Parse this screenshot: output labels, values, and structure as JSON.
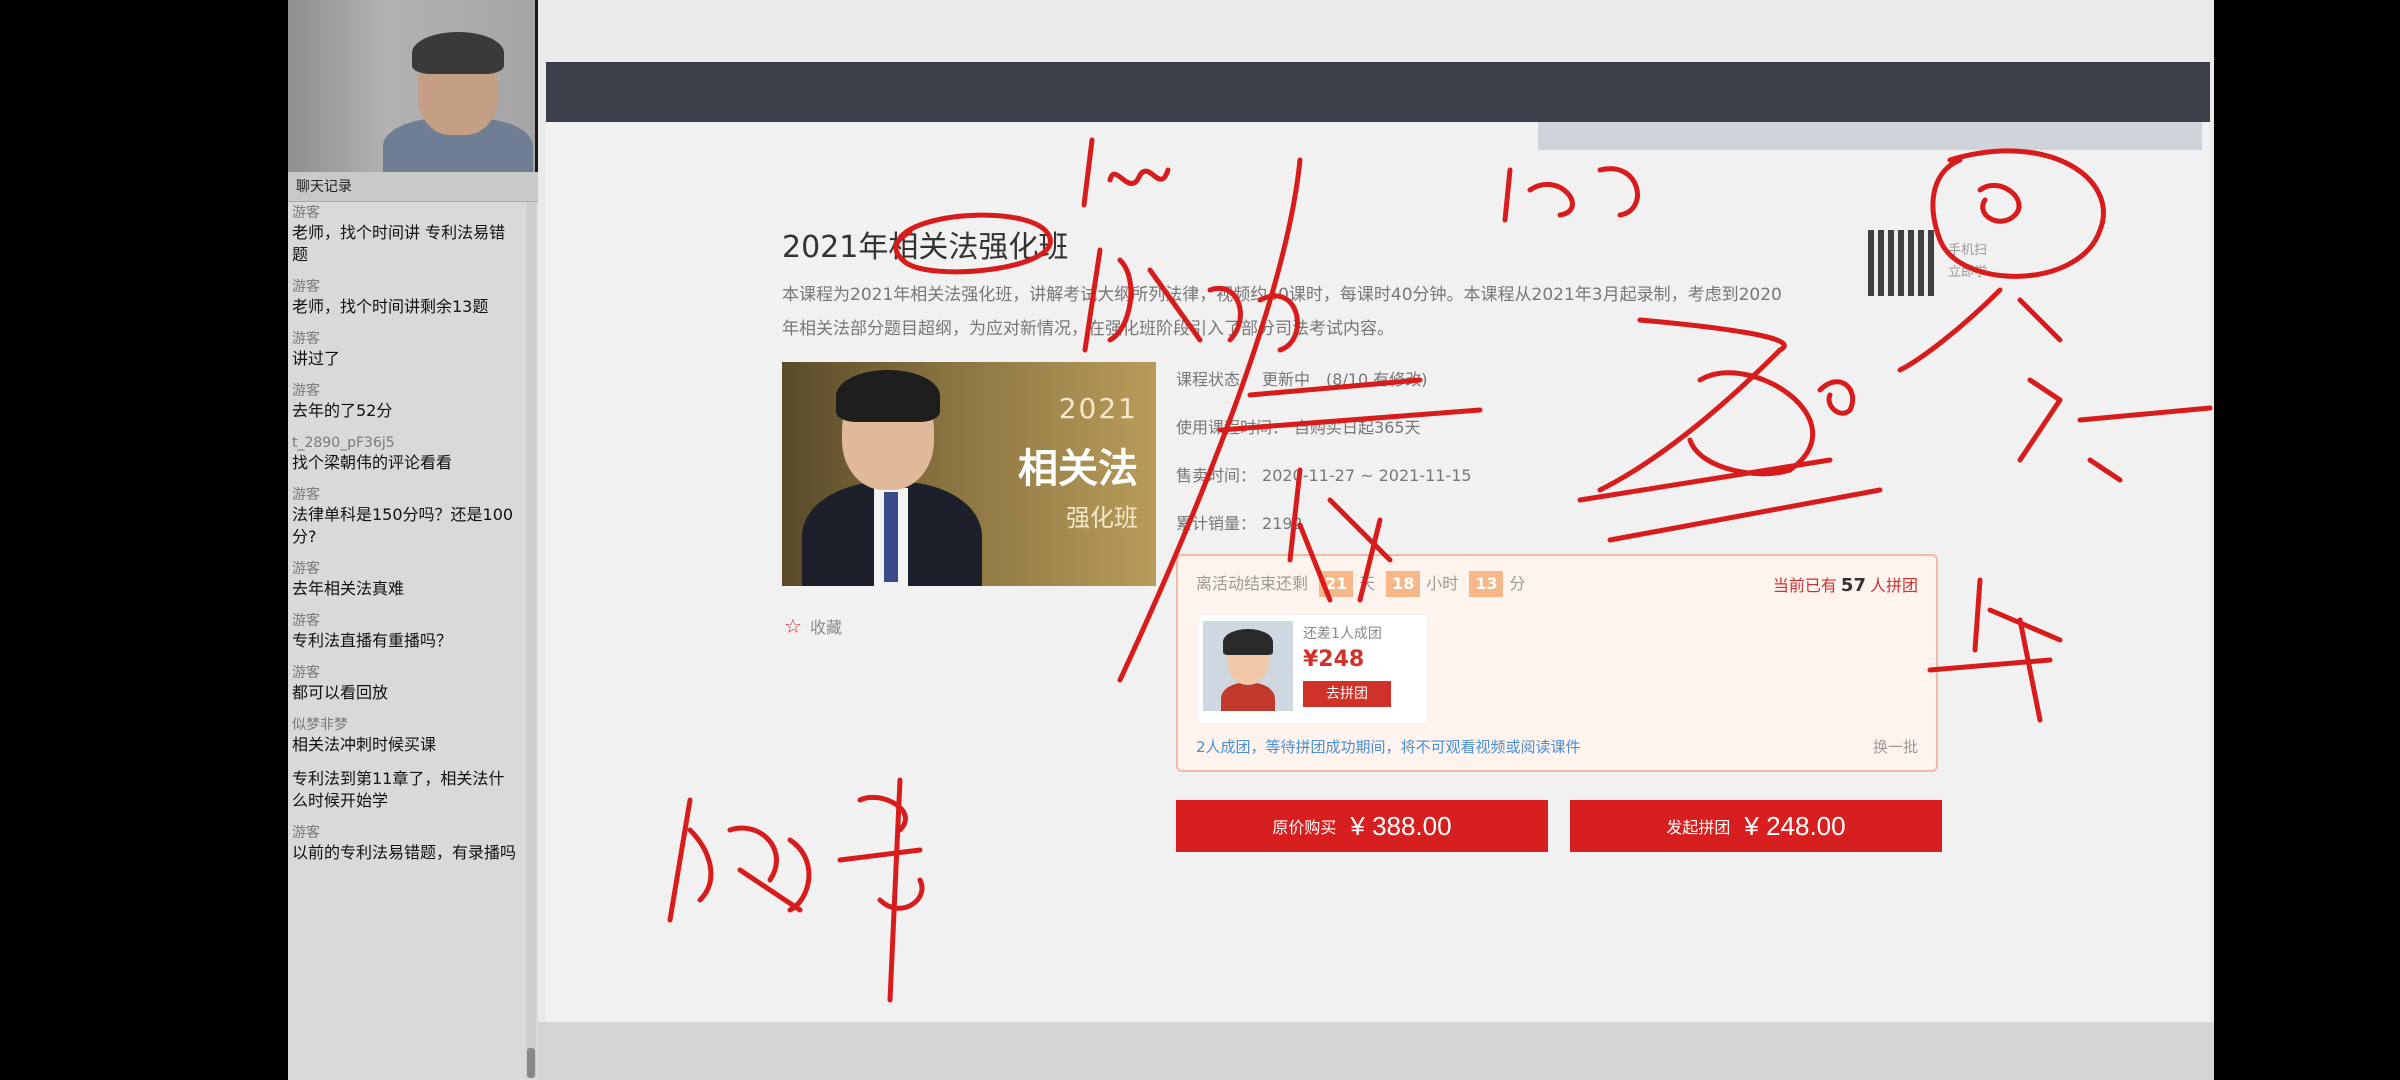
{
  "chat": {
    "header": "聊天记录",
    "messages": [
      {
        "user": "游客",
        "text": "老师，找个时间讲 专利法易错题"
      },
      {
        "user": "游客",
        "text": "老师，找个时间讲剩余13题"
      },
      {
        "user": "游客",
        "text": "讲过了"
      },
      {
        "user": "游客",
        "text": "去年的了52分"
      },
      {
        "user": "t_2890_pF36j5",
        "text": "找个梁朝伟的评论看看"
      },
      {
        "user": "游客",
        "text": "法律单科是150分吗？还是100分?"
      },
      {
        "user": "游客",
        "text": "去年相关法真难"
      },
      {
        "user": "游客",
        "text": "专利法直播有重播吗？"
      },
      {
        "user": "游客",
        "text": "都可以看回放"
      },
      {
        "user": "似梦非梦",
        "text": "相关法冲刺时候买课"
      },
      {
        "user": "",
        "text": "专利法到第11章了，相关法什么时候开始学"
      },
      {
        "user": "游客",
        "text": "以前的专利法易错题，有录播吗"
      }
    ]
  },
  "course": {
    "title": "2021年相关法强化班",
    "description": "本课程为2021年相关法强化班，讲解考试大纲所列法律，视频约40课时，每课时40分钟。本课程从2021年3月起录制，考虑到2020年相关法部分题目超纲，为应对新情况，在强化班阶段引入了部分司法考试内容。",
    "poster": {
      "year": "2021",
      "name": "相关法",
      "subtitle": "强化班"
    },
    "status_label": "课程状态：",
    "status_value": "更新中　(8/10 有修改)",
    "usage_label": "使用课程时间：",
    "usage_value": "自购买日起365天",
    "sale_label": "售卖时间：",
    "sale_value": "2020-11-27 ~ 2021-11-15",
    "sales_label": "累计销量：",
    "sales_value": "2192",
    "favorite": "收藏",
    "qr_caption_line1": "手机扫",
    "qr_caption_line2": "立即学"
  },
  "group_buy": {
    "countdown_prefix": "离活动结束还剩",
    "days": "21",
    "days_unit": "天",
    "hours": "18",
    "hours_unit": "小时",
    "minutes": "13",
    "minutes_unit": "分",
    "current_prefix": "当前已有",
    "current_count": "57",
    "current_suffix": "人拼团",
    "member_need": "还差1人成团",
    "member_price": "¥248",
    "join_button": "去拼团",
    "note": "2人成团，等待拼团成功期间，将不可观看视频或阅读课件",
    "more": "换一批"
  },
  "buttons": {
    "original_label": "原价购买",
    "original_price": "¥ 388.00",
    "group_label": "发起拼团",
    "group_price": "¥ 248.00"
  },
  "colors": {
    "ink": "#d81c1c",
    "buy_button": "#d81f1f",
    "top_band": "#3b3f4a"
  }
}
